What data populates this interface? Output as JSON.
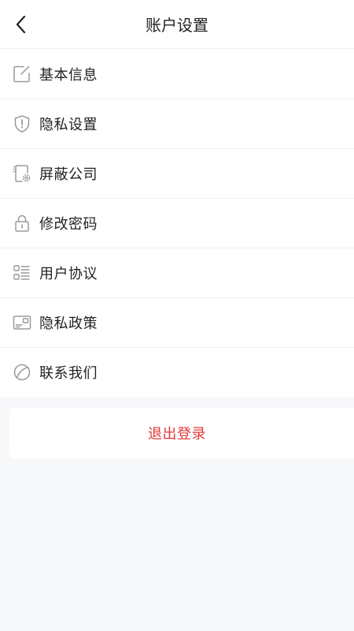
{
  "header": {
    "title": "账户设置",
    "back_icon": "chevron-left-icon"
  },
  "menu": {
    "items": [
      {
        "label": "基本信息",
        "icon": "edit-icon"
      },
      {
        "label": "隐私设置",
        "icon": "shield-alert-icon"
      },
      {
        "label": "屏蔽公司",
        "icon": "block-company-icon"
      },
      {
        "label": "修改密码",
        "icon": "lock-icon"
      },
      {
        "label": "用户协议",
        "icon": "list-icon"
      },
      {
        "label": "隐私政策",
        "icon": "card-icon"
      },
      {
        "label": "联系我们",
        "icon": "leaf-icon"
      }
    ]
  },
  "logout": {
    "label": "退出登录",
    "color": "#e03a3a"
  },
  "colors": {
    "icon_stroke": "#9a9a9a",
    "background": "#f7f8fa"
  }
}
